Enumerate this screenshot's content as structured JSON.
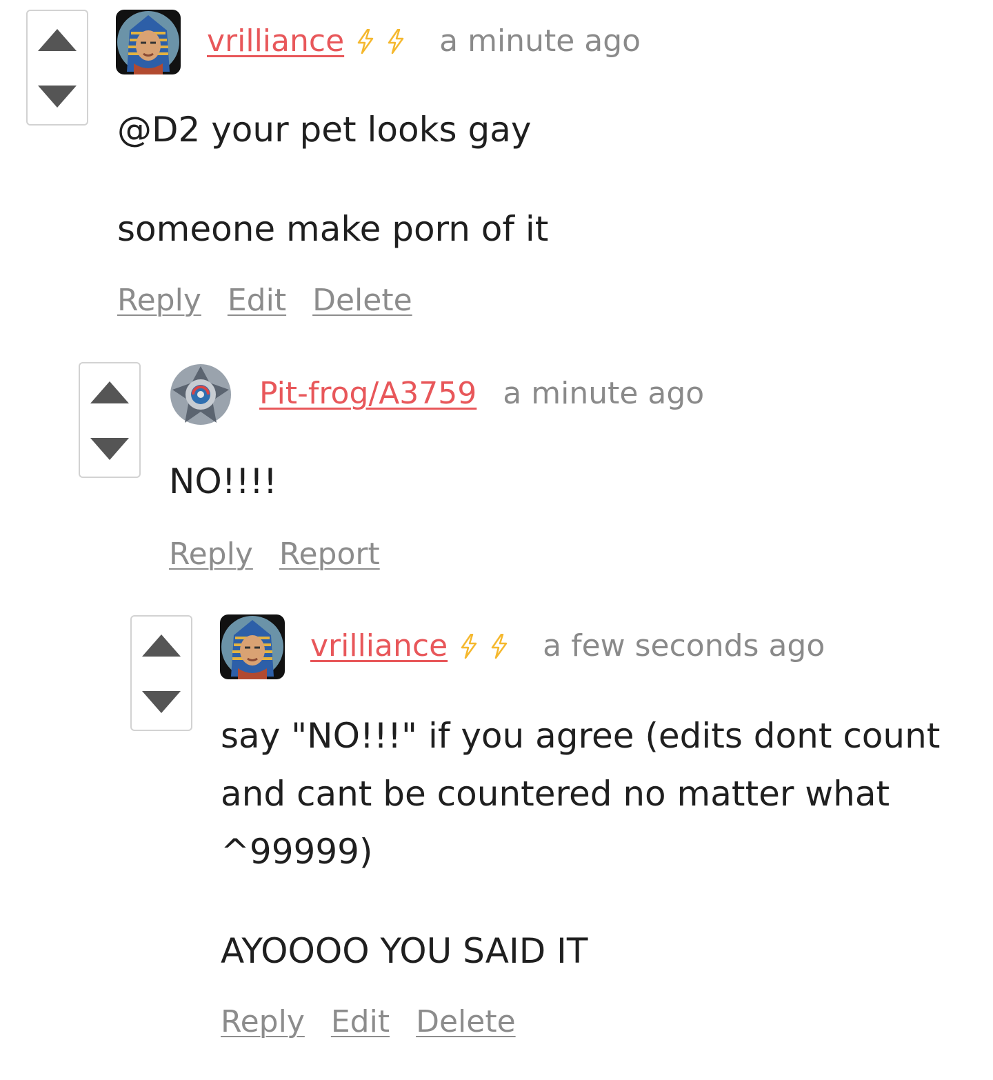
{
  "comments": [
    {
      "username": "vrilliance",
      "bolts": 2,
      "time": "a minute ago",
      "paragraphs": [
        "@D2 your pet looks gay",
        "someone make porn of it"
      ],
      "actions": [
        "Reply",
        "Edit",
        "Delete"
      ]
    },
    {
      "username": "Pit-frog/A3759",
      "bolts": 0,
      "time": "a minute ago",
      "paragraphs": [
        "NO!!!!"
      ],
      "actions": [
        "Reply",
        "Report"
      ]
    },
    {
      "username": "vrilliance",
      "bolts": 2,
      "time": "a few seconds ago",
      "paragraphs": [
        "say \"NO!!!\" if you agree (edits dont count and cant be countered no matter what ^99999)",
        "AYOOOO YOU SAID IT"
      ],
      "actions": [
        "Reply",
        "Edit",
        "Delete"
      ]
    }
  ],
  "colors": {
    "username": "#e8575a",
    "meta": "#8a8a8a",
    "arrow": "#555555",
    "bolt": "#f5b82e"
  }
}
